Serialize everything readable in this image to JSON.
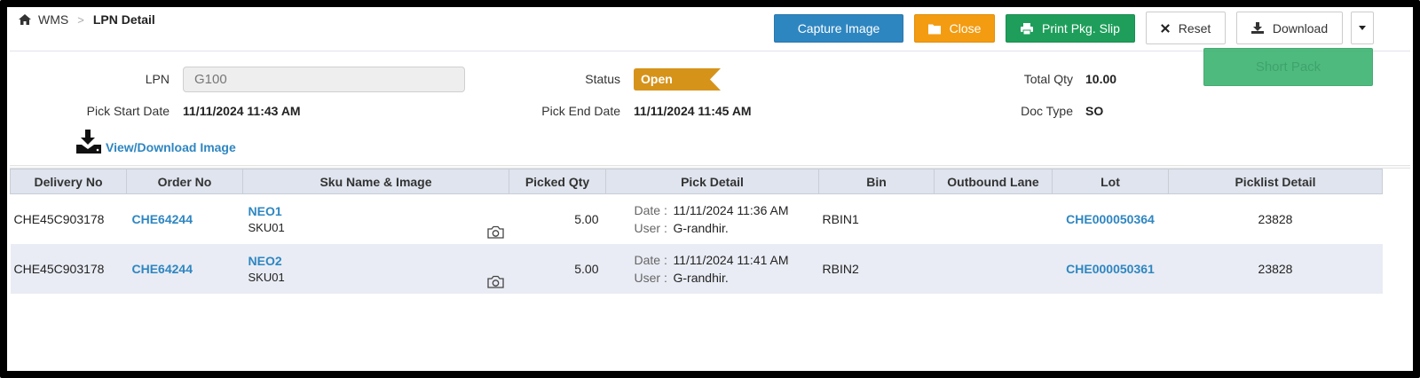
{
  "breadcrumb": {
    "root": "WMS",
    "separator": ">",
    "current": "LPN Detail"
  },
  "toolbar": {
    "capture_label": "Capture Image",
    "close_label": "Close",
    "print_label": "Print Pkg. Slip",
    "reset_label": "Reset",
    "download_label": "Download",
    "shortpack_label": "Short Pack"
  },
  "form": {
    "lpn_label": "LPN",
    "lpn_value": "G100",
    "status_label": "Status",
    "status_value": "Open",
    "total_qty_label": "Total Qty",
    "total_qty_value": "10.00",
    "pick_start_label": "Pick Start Date",
    "pick_start_value": "11/11/2024 11:43 AM",
    "pick_end_label": "Pick End Date",
    "pick_end_value": "11/11/2024 11:45 AM",
    "doc_type_label": "Doc Type",
    "doc_type_value": "SO",
    "view_download_label": "View/Download Image"
  },
  "table": {
    "headers": [
      "Delivery No",
      "Order No",
      "Sku Name & Image",
      "Picked Qty",
      "Pick Detail",
      "Bin",
      "Outbound Lane",
      "Lot",
      "Picklist Detail"
    ],
    "date_key": "Date :",
    "user_key": "User :",
    "rows": [
      {
        "delivery_no": "CHE45C903178",
        "order_no": "CHE64244",
        "sku_name": "NEO1",
        "sku_code": "SKU01",
        "picked_qty": "5.00",
        "date": "11/11/2024 11:36 AM",
        "user": "G-randhir.",
        "bin": "RBIN1",
        "outbound_lane": "",
        "lot": "CHE000050364",
        "picklist": "23828"
      },
      {
        "delivery_no": "CHE45C903178",
        "order_no": "CHE64244",
        "sku_name": "NEO2",
        "sku_code": "SKU01",
        "picked_qty": "5.00",
        "date": "11/11/2024 11:41 AM",
        "user": "G-randhir.",
        "bin": "RBIN2",
        "outbound_lane": "",
        "lot": "CHE000050361",
        "picklist": "23828"
      }
    ]
  },
  "colors": {
    "capture": "#2e86c1",
    "close": "#f39c12",
    "print": "#1e9e5a",
    "shortpack": "#3cb371",
    "status": "#d6931a",
    "link": "#2e86c1",
    "header_bg": "#dfe4ee",
    "alt_row": "#e9ecf4"
  },
  "icons": {
    "home": "home-icon",
    "close": "folder-icon",
    "print": "printer-icon",
    "reset": "x-icon",
    "download": "download-icon",
    "dropdown": "caret-down-icon",
    "view_download": "download-tray-icon",
    "sku_image": "camera-icon"
  }
}
